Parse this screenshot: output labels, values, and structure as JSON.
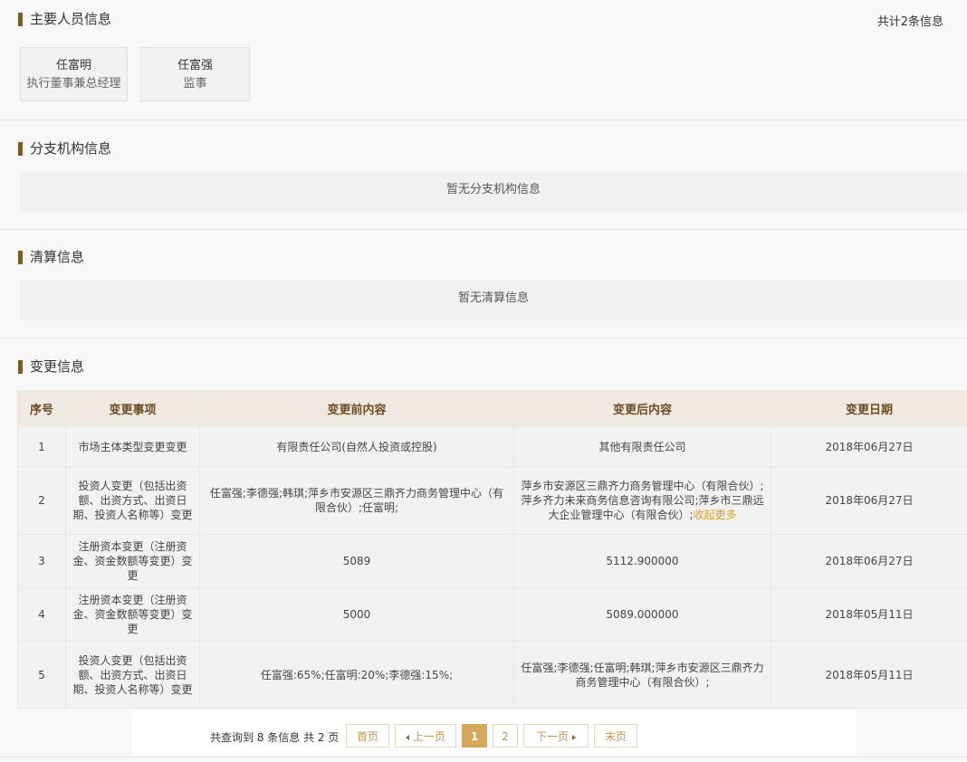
{
  "main_persons": {
    "title": "主要人员信息",
    "count": "共计2条信息",
    "persons": [
      {
        "name": "任富明",
        "role": "执行董事兼总经理"
      },
      {
        "name": "任富强",
        "role": "监事"
      }
    ]
  },
  "branches": {
    "title": "分支机构信息",
    "empty": "暂无分支机构信息"
  },
  "liquidation": {
    "title": "清算信息",
    "empty": "暂无清算信息"
  },
  "changes": {
    "title": "变更信息",
    "headers": [
      "序号",
      "变更事项",
      "变更前内容",
      "变更后内容",
      "变更日期"
    ],
    "rows": [
      {
        "no": "1",
        "item": "市场主体类型变更变更",
        "before": "有限责任公司(自然人投资或控股)",
        "after": "其他有限责任公司",
        "after_more": "",
        "date": "2018年06月27日"
      },
      {
        "no": "2",
        "item": "投资人变更（包括出资额、出资方式、出资日期、投资人名称等）变更",
        "before": "任富强;李德强;韩琪;萍乡市安源区三鼎齐力商务管理中心（有限合伙）;任富明;",
        "after": "萍乡市安源区三鼎齐力商务管理中心（有限合伙）;萍乡齐力未来商务信息咨询有限公司;萍乡市三鼎远大企业管理中心（有限合伙）;",
        "after_more": "收起更多",
        "date": "2018年06月27日"
      },
      {
        "no": "3",
        "item": "注册资本变更（注册资金、资金数额等变更）变更",
        "before": "5089",
        "after": "5112.900000",
        "after_more": "",
        "date": "2018年06月27日"
      },
      {
        "no": "4",
        "item": "注册资本变更（注册资金、资金数额等变更）变更",
        "before": "5000",
        "after": "5089.000000",
        "after_more": "",
        "date": "2018年05月11日"
      },
      {
        "no": "5",
        "item": "投资人变更（包括出资额、出资方式、出资日期、投资人名称等）变更",
        "before": "任富强:65%;任富明:20%;李德强:15%;",
        "after": "任富强;李德强;任富明;韩琪;萍乡市安源区三鼎齐力商务管理中心（有限合伙）;",
        "after_more": "",
        "date": "2018年05月11日"
      }
    ]
  },
  "pagination": {
    "info": "共查询到 8 条信息   共 2 页",
    "first": "首页",
    "prev": "上一页",
    "pages": [
      "1",
      "2"
    ],
    "current": "1",
    "next": "下一页",
    "last": "末页"
  },
  "colors": {
    "accent": "#d4a95a",
    "header_bg": "#efe9e1",
    "title_bar": "#7a5a2a",
    "link": "#d9a027"
  }
}
